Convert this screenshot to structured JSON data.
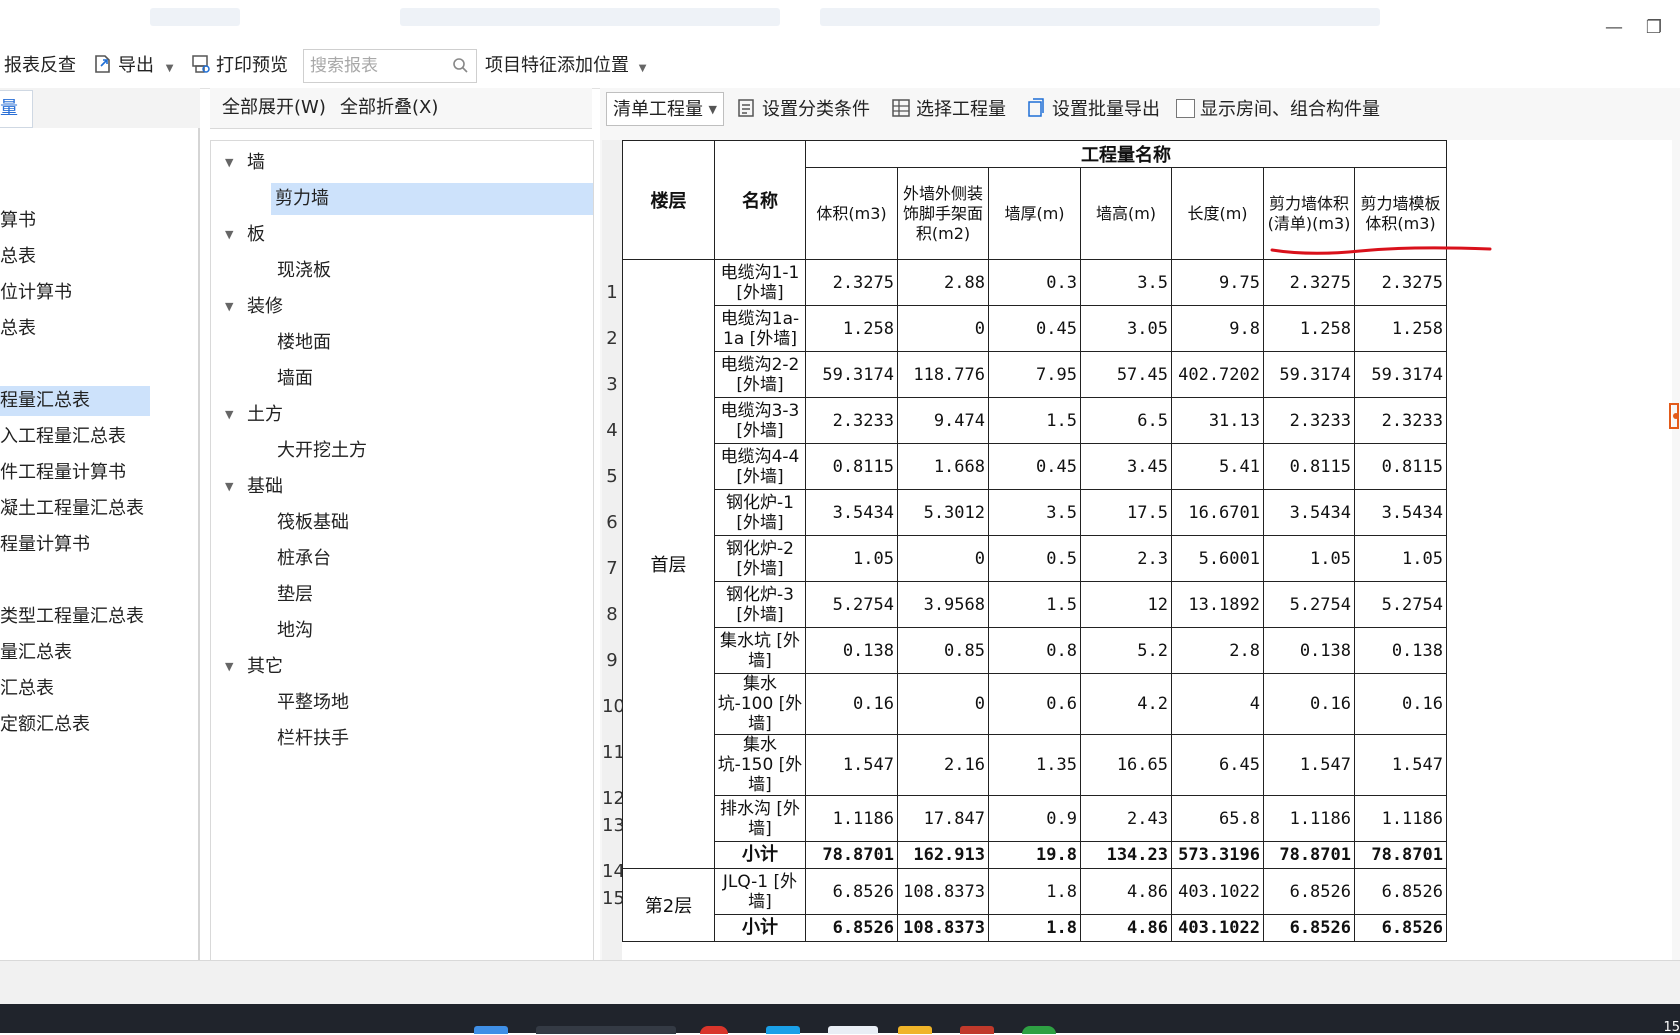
{
  "toolbar": {
    "report_check": "报表反查",
    "export": "导出",
    "print_preview": "打印预览",
    "search_placeholder": "搜索报表",
    "feature_position": "项目特征添加位置"
  },
  "left_panel": {
    "tab_label": "表量",
    "items": [
      {
        "label": "算书",
        "selected": false
      },
      {
        "label": "总表",
        "selected": false
      },
      {
        "label": "位计算书",
        "selected": false
      },
      {
        "label": "总表",
        "selected": false
      },
      {
        "label": "程量汇总表",
        "selected": true
      },
      {
        "label": "入工程量汇总表",
        "selected": false
      },
      {
        "label": "件工程量计算书",
        "selected": false
      },
      {
        "label": "凝土工程量汇总表",
        "selected": false
      },
      {
        "label": "程量计算书",
        "selected": false
      },
      {
        "label": "类型工程量汇总表",
        "selected": false
      },
      {
        "label": "量汇总表",
        "selected": false
      },
      {
        "label": "汇总表",
        "selected": false
      },
      {
        "label": "定额汇总表",
        "selected": false
      }
    ]
  },
  "tree_panel": {
    "expand_all": "全部展开(W)",
    "collapse_all": "全部折叠(X)",
    "nodes": [
      {
        "label": "墙",
        "level": 0
      },
      {
        "label": "剪力墙",
        "level": 1,
        "selected": true
      },
      {
        "label": "板",
        "level": 0
      },
      {
        "label": "现浇板",
        "level": 1
      },
      {
        "label": "装修",
        "level": 0
      },
      {
        "label": "楼地面",
        "level": 1
      },
      {
        "label": "墙面",
        "level": 1
      },
      {
        "label": "土方",
        "level": 0
      },
      {
        "label": "大开挖土方",
        "level": 1
      },
      {
        "label": "基础",
        "level": 0
      },
      {
        "label": "筏板基础",
        "level": 1
      },
      {
        "label": "桩承台",
        "level": 1
      },
      {
        "label": "垫层",
        "level": 1
      },
      {
        "label": "地沟",
        "level": 1
      },
      {
        "label": "其它",
        "level": 0
      },
      {
        "label": "平整场地",
        "level": 1
      },
      {
        "label": "栏杆扶手",
        "level": 1
      }
    ]
  },
  "right_toolbar": {
    "quantity_type": "清单工程量",
    "set_category": "设置分类条件",
    "select_quantity": "选择工程量",
    "batch_export": "设置批量导出",
    "show_rooms": "显示房间、组合构件量"
  },
  "report": {
    "header_group": "工程量名称",
    "col_floor": "楼层",
    "col_name": "名称",
    "columns": [
      "体积(m3)",
      "外墙外侧装饰脚手架面积(m2)",
      "墙厚(m)",
      "墙高(m)",
      "长度(m)",
      "剪力墙体积(清单)(m3)",
      "剪力墙模板体积(m3)"
    ],
    "groups": [
      {
        "floor": "首层",
        "rows": [
          {
            "no": "1",
            "name": "电缆沟1-1 [外墙]",
            "values": [
              "2.3275",
              "2.88",
              "0.3",
              "3.5",
              "9.75",
              "2.3275",
              "2.3275"
            ]
          },
          {
            "no": "2",
            "name": "电缆沟1a-1a [外墙]",
            "values": [
              "1.258",
              "0",
              "0.45",
              "3.05",
              "9.8",
              "1.258",
              "1.258"
            ]
          },
          {
            "no": "3",
            "name": "电缆沟2-2 [外墙]",
            "values": [
              "59.3174",
              "118.776",
              "7.95",
              "57.45",
              "402.7202",
              "59.3174",
              "59.3174"
            ]
          },
          {
            "no": "4",
            "name": "电缆沟3-3 [外墙]",
            "values": [
              "2.3233",
              "9.474",
              "1.5",
              "6.5",
              "31.13",
              "2.3233",
              "2.3233"
            ]
          },
          {
            "no": "5",
            "name": "电缆沟4-4 [外墙]",
            "values": [
              "0.8115",
              "1.668",
              "0.45",
              "3.45",
              "5.41",
              "0.8115",
              "0.8115"
            ]
          },
          {
            "no": "6",
            "name": "钢化炉-1 [外墙]",
            "values": [
              "3.5434",
              "5.3012",
              "3.5",
              "17.5",
              "16.6701",
              "3.5434",
              "3.5434"
            ]
          },
          {
            "no": "7",
            "name": "钢化炉-2 [外墙]",
            "values": [
              "1.05",
              "0",
              "0.5",
              "2.3",
              "5.6001",
              "1.05",
              "1.05"
            ]
          },
          {
            "no": "8",
            "name": "钢化炉-3 [外墙]",
            "values": [
              "5.2754",
              "3.9568",
              "1.5",
              "12",
              "13.1892",
              "5.2754",
              "5.2754"
            ]
          },
          {
            "no": "9",
            "name": "集水坑 [外墙]",
            "values": [
              "0.138",
              "0.85",
              "0.8",
              "5.2",
              "2.8",
              "0.138",
              "0.138"
            ]
          },
          {
            "no": "10",
            "name": "集水坑-100 [外墙]",
            "values": [
              "0.16",
              "0",
              "0.6",
              "4.2",
              "4",
              "0.16",
              "0.16"
            ]
          },
          {
            "no": "11",
            "name": "集水坑-150 [外墙]",
            "values": [
              "1.547",
              "2.16",
              "1.35",
              "16.65",
              "6.45",
              "1.547",
              "1.547"
            ]
          },
          {
            "no": "12",
            "name": "排水沟 [外墙]",
            "values": [
              "1.1186",
              "17.847",
              "0.9",
              "2.43",
              "65.8",
              "1.1186",
              "1.1186"
            ]
          },
          {
            "no": "13",
            "name": "小计",
            "subtotal": true,
            "values": [
              "78.8701",
              "162.913",
              "19.8",
              "134.23",
              "573.3196",
              "78.8701",
              "78.8701"
            ]
          }
        ]
      },
      {
        "floor": "第2层",
        "rows": [
          {
            "no": "14",
            "name": "JLQ-1 [外墙]",
            "values": [
              "6.8526",
              "108.8373",
              "1.8",
              "4.86",
              "403.1022",
              "6.8526",
              "6.8526"
            ]
          },
          {
            "no": "15",
            "name": "小计",
            "subtotal": true,
            "values": [
              "6.8526",
              "108.8373",
              "1.8",
              "4.86",
              "403.1022",
              "6.8526",
              "6.8526"
            ]
          }
        ]
      }
    ]
  },
  "taskbar": {
    "clock": "15"
  },
  "colors": {
    "selection": "#cde2fb",
    "accent": "#2a6fd6",
    "annotation": "#d9111b"
  }
}
